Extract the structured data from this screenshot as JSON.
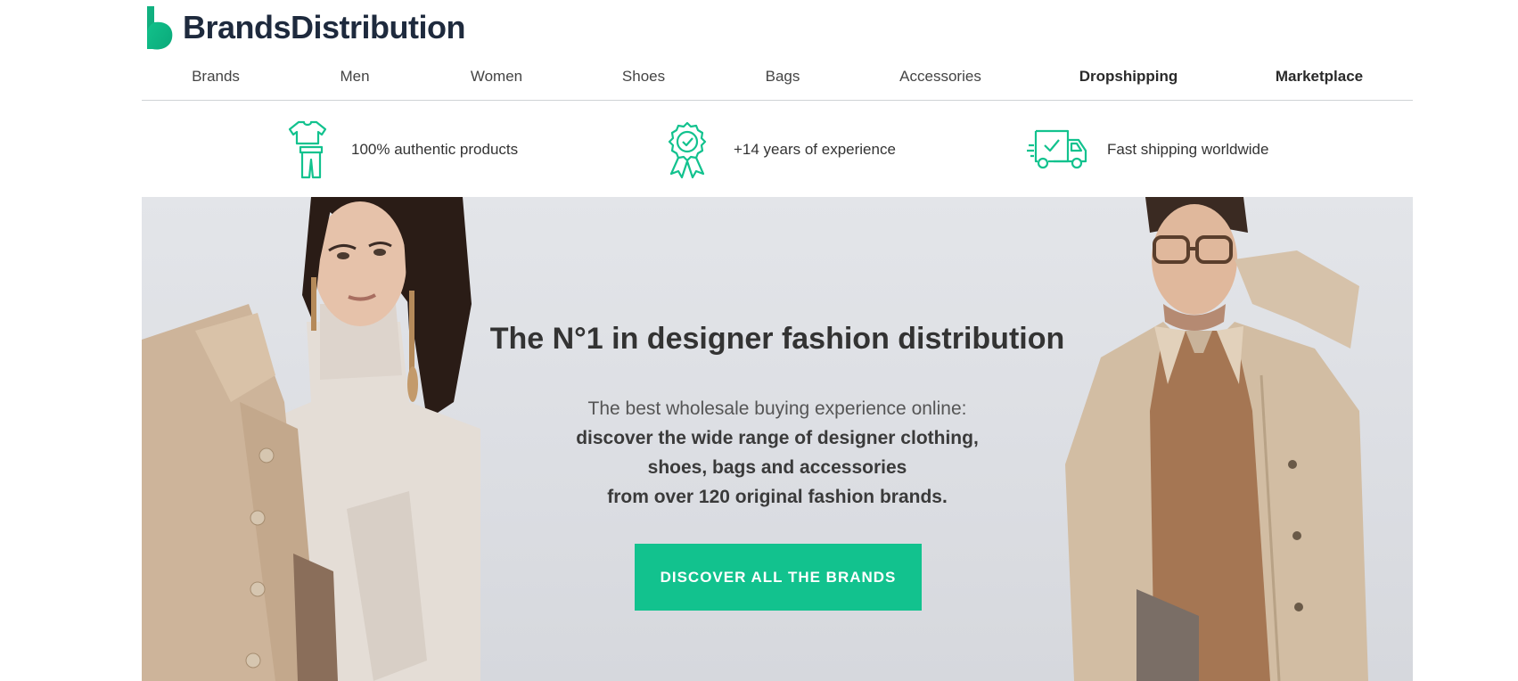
{
  "brand": {
    "name": "BrandsDistribution",
    "accent_color": "#12c28e",
    "text_color": "#1e2a3d"
  },
  "nav": {
    "items": [
      {
        "label": "Brands",
        "bold": false
      },
      {
        "label": "Men",
        "bold": false
      },
      {
        "label": "Women",
        "bold": false
      },
      {
        "label": "Shoes",
        "bold": false
      },
      {
        "label": "Bags",
        "bold": false
      },
      {
        "label": "Accessories",
        "bold": false
      },
      {
        "label": "Dropshipping",
        "bold": true
      },
      {
        "label": "Marketplace",
        "bold": true
      }
    ]
  },
  "features": [
    {
      "icon": "clothing-icon",
      "text": "100% authentic products"
    },
    {
      "icon": "award-badge-icon",
      "text": "+14 years of experience"
    },
    {
      "icon": "delivery-truck-icon",
      "text": "Fast shipping worldwide"
    }
  ],
  "hero": {
    "title": "The N°1 in designer fashion distribution",
    "line1": "The best wholesale buying experience online:",
    "line2": "discover the wide range of designer clothing,",
    "line3": "shoes, bags and accessories",
    "line4": "from over 120 original fashion brands.",
    "cta_label": "DISCOVER ALL THE BRANDS",
    "left_image": "woman-model-image",
    "right_image": "man-model-image"
  }
}
